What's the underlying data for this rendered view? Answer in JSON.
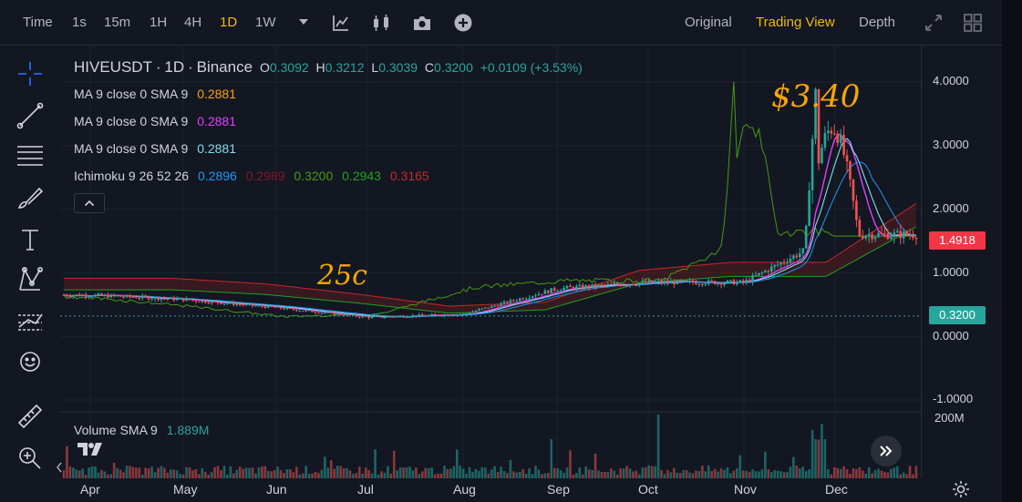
{
  "toolbar": {
    "timeframes": [
      {
        "label": "Time",
        "active": false
      },
      {
        "label": "1s",
        "active": false
      },
      {
        "label": "15m",
        "active": false
      },
      {
        "label": "1H",
        "active": false
      },
      {
        "label": "4H",
        "active": false
      },
      {
        "label": "1D",
        "active": true
      },
      {
        "label": "1W",
        "active": false
      }
    ],
    "icons": [
      "chevron-down-icon",
      "indicator-chart-icon",
      "candles-icon",
      "camera-icon",
      "add-icon"
    ],
    "views": [
      {
        "label": "Original",
        "active": false
      },
      {
        "label": "Trading View",
        "active": true
      },
      {
        "label": "Depth",
        "active": false
      }
    ],
    "right_icons": [
      "expand-icon",
      "layout-grid-icon"
    ]
  },
  "left_tools": [
    "crosshair-icon",
    "trend-line-icon",
    "horizontal-lines-icon",
    "brush-icon",
    "text-icon",
    "pattern-icon",
    "forecast-icon",
    "emoji-icon",
    "ruler-icon",
    "zoom-icon"
  ],
  "legend": {
    "symbol": "HIVEUSDT",
    "sep1": "·",
    "interval": "1D",
    "sep2": "·",
    "exchange": "Binance",
    "o_label": "O",
    "o": "0.3092",
    "h_label": "H",
    "h": "0.3212",
    "l_label": "L",
    "l": "0.3039",
    "c_label": "C",
    "c": "0.3200",
    "change": "+0.0109 (+3.53%)",
    "ma": [
      {
        "label": "MA 9 close 0 SMA 9",
        "value": "0.2881",
        "color": "#f7a600"
      },
      {
        "label": "MA 9 close 0 SMA 9",
        "value": "0.2881",
        "color": "#e040fb"
      },
      {
        "label": "MA 9 close 0 SMA 9",
        "value": "0.2881",
        "color": "#80deea"
      }
    ],
    "ichimoku_label": "Ichimoku 9 26 52 26",
    "ichimoku": [
      {
        "value": "0.2896",
        "color": "#2196f3"
      },
      {
        "value": "0.2989",
        "color": "#801922"
      },
      {
        "value": "0.3200",
        "color": "#459915"
      },
      {
        "value": "0.2943",
        "color": "#21a121"
      },
      {
        "value": "0.3165",
        "color": "#c62828"
      }
    ],
    "volume_label": "Volume SMA 9",
    "volume_value": "1.889M"
  },
  "annotations": [
    {
      "text": "$3.40",
      "color": "#f7a600"
    },
    {
      "text": "25c",
      "color": "#f7a600"
    }
  ],
  "axis": {
    "y_labels": [
      "4.0000",
      "3.0000",
      "2.0000",
      "1.0000",
      "0.0000",
      "-1.0000"
    ],
    "volume_label": "200M",
    "current_price": "0.3200",
    "current_price_color": "#26a69a",
    "marker_price": "1.4918",
    "marker_price_color": "#f23645"
  },
  "chart_data": {
    "type": "candlestick",
    "title": "HIVEUSDT · 1D · Binance",
    "x_labels": [
      "Apr",
      "May",
      "Jun",
      "Jul",
      "Aug",
      "Sep",
      "Oct",
      "Nov",
      "Dec"
    ],
    "ylim": [
      -1.1,
      4.3
    ],
    "y_ticks": [
      4,
      3,
      2,
      1,
      0,
      -1
    ],
    "series": [
      {
        "name": "price_close_approx",
        "months": [
          "Apr",
          "May",
          "Jun",
          "Jul",
          "Aug",
          "Sep",
          "Oct",
          "Nov",
          "Dec"
        ],
        "values": [
          0.65,
          0.58,
          0.45,
          0.3,
          0.35,
          0.75,
          0.85,
          0.85,
          1.6
        ]
      },
      {
        "name": "peak",
        "value": 3.4,
        "month": "late Nov"
      }
    ],
    "current_price": 0.32,
    "marker_price": 1.4918,
    "colors": {
      "up": "#26a69a",
      "down": "#ef5350",
      "cloud": "#7a1c1c",
      "lagging": "#459915"
    },
    "grid": true
  }
}
